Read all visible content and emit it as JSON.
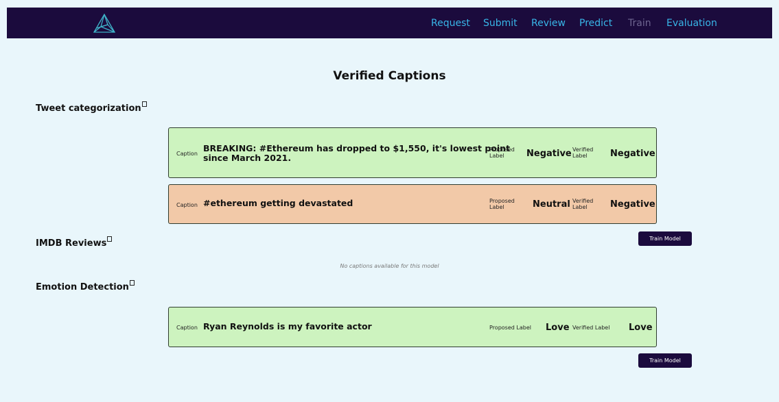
{
  "nav": {
    "links": [
      {
        "label": "Request",
        "active": true
      },
      {
        "label": "Submit",
        "active": true
      },
      {
        "label": "Review",
        "active": true
      },
      {
        "label": "Predict",
        "active": true
      },
      {
        "label": "Train",
        "active": false
      },
      {
        "label": "Evaluation",
        "active": true
      }
    ],
    "logo_icon": "triangle-network-logo"
  },
  "page_title": "Verified Captions",
  "colors": {
    "navbar": "#1b0b3d",
    "nav_link": "#38b6e8",
    "nav_link_disabled": "#6e6590",
    "background": "#e9f6fb",
    "match_card": "#cdf3bf",
    "mismatch_card": "#f2c9a8",
    "button": "#1b0b3d"
  },
  "sections": {
    "tweet": {
      "title": "Tweet categorization",
      "cards": [
        {
          "caption_label": "Caption",
          "caption_lines": [
            "BREAKING: #Ethereum has dropped to $1,550, it's lowest point",
            "since March 2021."
          ],
          "proposed_label_lines": [
            "Proposed",
            "Label"
          ],
          "proposed_value": "Negative",
          "verified_label_lines": [
            "Verified",
            "Label"
          ],
          "verified_value": "Negative"
        },
        {
          "caption_label": "Caption",
          "caption": "#ethereum getting devastated",
          "proposed_label_lines": [
            "Proposed",
            "Label"
          ],
          "proposed_value": "Neutral",
          "verified_label_lines": [
            "Verified",
            "Label"
          ],
          "verified_value": "Negative"
        }
      ],
      "train_button": "Train Model"
    },
    "imdb": {
      "title": "IMDB Reviews",
      "empty_message": "No captions available for this model"
    },
    "emotion": {
      "title": "Emotion Detection",
      "cards": [
        {
          "caption_label": "Caption",
          "caption": "Ryan Reynolds is my favorite actor",
          "proposed_label": "Proposed Label",
          "proposed_value": "Love",
          "verified_label": "Verified Label",
          "verified_value": "Love"
        }
      ],
      "train_button": "Train Model"
    }
  },
  "icons": {
    "section_info": "info-icon"
  }
}
